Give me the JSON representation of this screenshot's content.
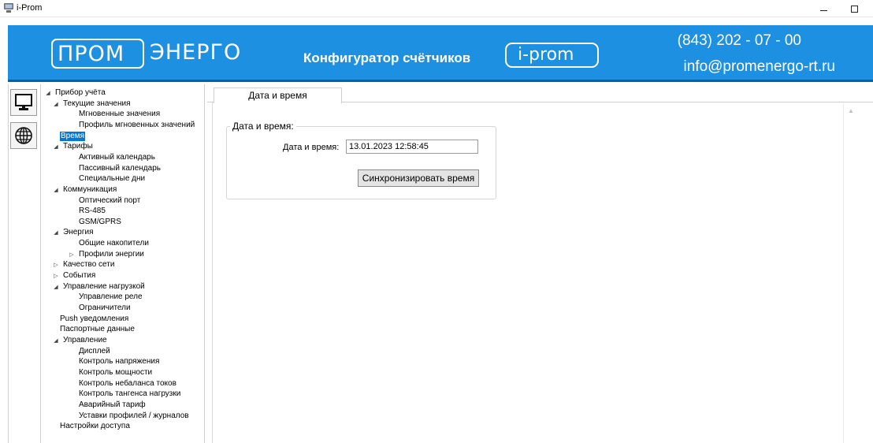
{
  "window": {
    "title": "i-Prom"
  },
  "banner": {
    "logo_prom": "ПРОМ",
    "logo_energo": "ЭНЕРГО",
    "caption": "Конфигуратор счётчиков",
    "logo_iprom": "i-prom",
    "phone": "(843) 202 - 07 - 00",
    "email": "info@promenergo-rt.ru",
    "color": "#1e90e2"
  },
  "tree": {
    "nodes": [
      {
        "label": "Прибор учёта",
        "arrow": "◢"
      },
      {
        "label": "Текущие значения",
        "arrow": "◢"
      },
      {
        "label": "Мгновенные значения",
        "arrow": ""
      },
      {
        "label": "Профиль мгновенных значений",
        "arrow": ""
      },
      {
        "label": "Время",
        "arrow": ""
      },
      {
        "label": "Тарифы",
        "arrow": "◢"
      },
      {
        "label": "Активный календарь",
        "arrow": ""
      },
      {
        "label": "Пассивный календарь",
        "arrow": ""
      },
      {
        "label": "Специальные дни",
        "arrow": ""
      },
      {
        "label": "Коммуникация",
        "arrow": "◢"
      },
      {
        "label": "Оптический порт",
        "arrow": ""
      },
      {
        "label": "RS-485",
        "arrow": ""
      },
      {
        "label": "GSM/GPRS",
        "arrow": ""
      },
      {
        "label": "Энергия",
        "arrow": "◢"
      },
      {
        "label": "Общие накопители",
        "arrow": ""
      },
      {
        "label": "Профили энергии",
        "arrow": "▷"
      },
      {
        "label": "Качество сети",
        "arrow": "▷"
      },
      {
        "label": "События",
        "arrow": "▷"
      },
      {
        "label": "Управление нагрузкой",
        "arrow": "◢"
      },
      {
        "label": "Управление реле",
        "arrow": ""
      },
      {
        "label": "Ограничители",
        "arrow": ""
      },
      {
        "label": "Push уведомления",
        "arrow": ""
      },
      {
        "label": "Паспортные данные",
        "arrow": ""
      },
      {
        "label": "Управление",
        "arrow": "◢"
      },
      {
        "label": "Дисплей",
        "arrow": ""
      },
      {
        "label": "Контроль напряжения",
        "arrow": ""
      },
      {
        "label": "Контроль мощности",
        "arrow": ""
      },
      {
        "label": "Контроль небаланса токов",
        "arrow": ""
      },
      {
        "label": "Контроль тангенса нагрузки",
        "arrow": ""
      },
      {
        "label": "Аварийный тариф",
        "arrow": ""
      },
      {
        "label": "Уставки профилей / журналов",
        "arrow": ""
      },
      {
        "label": "Настройки доступа",
        "arrow": ""
      }
    ],
    "selected": "Время"
  },
  "tab": {
    "label": "Дата и время"
  },
  "group": {
    "title": "Дата и время:",
    "field_label": "Дата и время:",
    "field_value": "13.01.2023 12:58:45",
    "sync_button": "Синхронизировать время"
  }
}
